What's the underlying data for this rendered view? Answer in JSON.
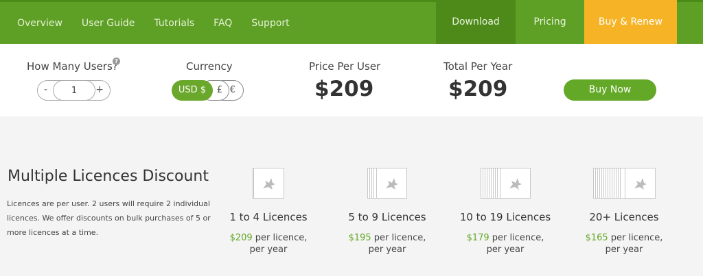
{
  "nav": {
    "items": [
      "Overview",
      "User Guide",
      "Tutorials",
      "FAQ",
      "Support"
    ],
    "download": "Download",
    "pricing": "Pricing",
    "buy_renew": "Buy & Renew"
  },
  "calculator": {
    "users_label": "How Many Users?",
    "help_symbol": "?",
    "users_value": "1",
    "minus": "-",
    "plus": "+",
    "currency_label": "Currency",
    "currencies": [
      "USD $",
      "£",
      "€"
    ],
    "selected_currency": "USD $",
    "price_per_user_label": "Price Per User",
    "price_per_user": "$209",
    "total_label": "Total Per Year",
    "total": "$209",
    "buy_now": "Buy Now"
  },
  "discount": {
    "title": "Multiple Licences Discount",
    "text": "Licences are per user. 2 users will require 2 individual licences. We offer discounts on bulk purchases of 5 or more licences at a time.",
    "tiers": [
      {
        "name": "1 to 4 Licences",
        "price": "$209",
        "unit": " per licence,",
        "period": "per year"
      },
      {
        "name": "5 to 9 Licences",
        "price": "$195",
        "unit": " per licence,",
        "period": "per year"
      },
      {
        "name": "10 to 19 Licences",
        "price": "$179",
        "unit": " per licence,",
        "period": "per year"
      },
      {
        "name": "20+ Licences",
        "price": "$165",
        "unit": " per licence,",
        "period": "per year"
      }
    ]
  },
  "colors": {
    "nav_green": "#5e9f25",
    "accent_yellow": "#f6b325",
    "button_green": "#63a826"
  }
}
